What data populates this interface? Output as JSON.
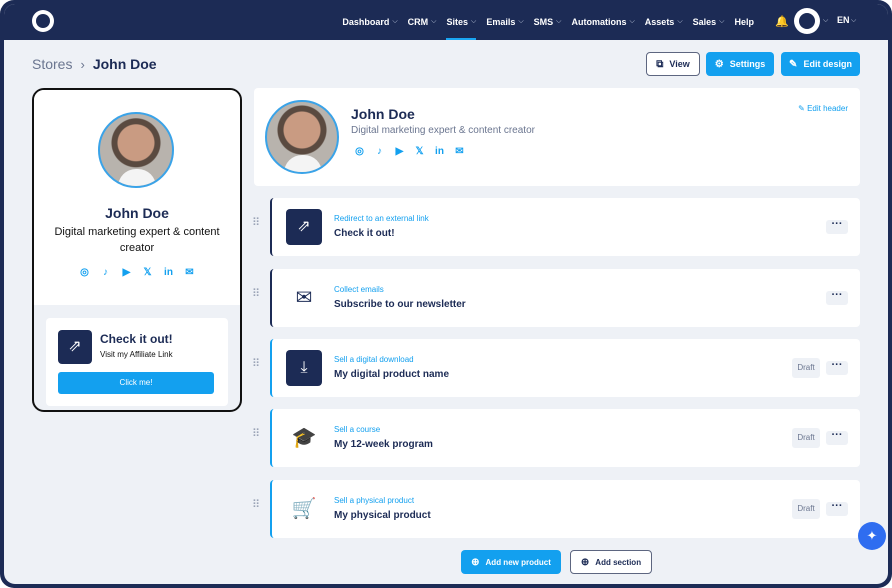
{
  "nav": {
    "items": [
      {
        "label": "Dashboard",
        "has_chevron": true,
        "active": false
      },
      {
        "label": "CRM",
        "has_chevron": true,
        "active": false
      },
      {
        "label": "Sites",
        "has_chevron": true,
        "active": true
      },
      {
        "label": "Emails",
        "has_chevron": true,
        "active": false
      },
      {
        "label": "SMS",
        "has_chevron": true,
        "active": false
      },
      {
        "label": "Automations",
        "has_chevron": true,
        "active": false
      },
      {
        "label": "Assets",
        "has_chevron": true,
        "active": false
      },
      {
        "label": "Sales",
        "has_chevron": true,
        "active": false
      },
      {
        "label": "Help",
        "has_chevron": false,
        "active": false
      }
    ],
    "language": "EN"
  },
  "breadcrumb": {
    "root": "Stores",
    "current": "John Doe"
  },
  "toolbar": {
    "view_label": "View",
    "settings_label": "Settings",
    "edit_design_label": "Edit design"
  },
  "preview": {
    "name": "John Doe",
    "bio": "Digital marketing expert & content creator",
    "card": {
      "title": "Check it out!",
      "subtitle": "Visit my Affiliate Link",
      "button_label": "Click me!"
    }
  },
  "header_card": {
    "name": "John Doe",
    "bio": "Digital marketing expert & content creator",
    "edit_label": "Edit header"
  },
  "social_icons": [
    "instagram-icon",
    "tiktok-icon",
    "youtube-icon",
    "x-icon",
    "linkedin-icon",
    "email-icon"
  ],
  "blocks": [
    {
      "type": "Redirect to an external link",
      "title": "Check it out!",
      "icon": "external-link-icon",
      "draft": false
    },
    {
      "type": "Collect emails",
      "title": "Subscribe to our newsletter",
      "icon": "envelope-icon",
      "draft": false
    },
    {
      "type": "Sell a digital download",
      "title": "My digital product name",
      "icon": "download-icon",
      "draft": true,
      "draft_label": "Draft"
    },
    {
      "type": "Sell a course",
      "title": "My 12-week program",
      "icon": "graduation-cap-icon",
      "draft": true,
      "draft_label": "Draft"
    },
    {
      "type": "Sell a physical product",
      "title": "My physical product",
      "icon": "cart-icon",
      "draft": true,
      "draft_label": "Draft"
    }
  ],
  "footer": {
    "add_product_label": "Add new product",
    "add_section_label": "Add section"
  },
  "colors": {
    "navy": "#1c2b55",
    "accent": "#13a0ef",
    "background": "#eef1f6"
  }
}
